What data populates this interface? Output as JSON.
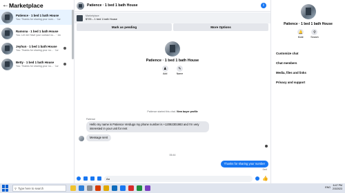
{
  "left": {
    "title": "Marketplace",
    "conversations": [
      {
        "name": "Patience · 1 bed 1 bath House",
        "snippet": "You: Thanks for sharing your num... · 1w"
      },
      {
        "name": "Ramona · 1 bed 1 bath House",
        "snippet": "You: Let me Have your contact nu... · 1w"
      },
      {
        "name": "Jeyhun · 1 bed 1 bath House",
        "snippet": "You: Thanks for sharing your nu... · 1w"
      },
      {
        "name": "Betty · 1 bed 1 bath House",
        "snippet": "You: Thanks for sharing your nu... · 1w"
      }
    ]
  },
  "middle": {
    "header_title": "Patience · 1 bed 1 bath House",
    "listing_label": "Marketplace",
    "listing_price": "$725 – 1 bed 1 bath House",
    "mark_pending": "Mark as pending",
    "more_options": "More Options",
    "profile_name": "Patience · 1 bed 1 bath House",
    "add_label": "Add",
    "name_label": "Name",
    "sys_msg_prefix": "Patience started this chat.",
    "sys_msg_link": "View buyer profile",
    "sender": "Patience",
    "msg1": "Hello my name is Patience Verdugo my phone number is +12092301983 and I'm very interested in your unit for rent",
    "msg2": "Message sent",
    "time": "06:44",
    "msg_out": "Thanks for sharing your number",
    "sent": "Sent",
    "composer_text": "Aa"
  },
  "right": {
    "name": "Patience · 1 bed 1 bath House",
    "mute": "Mute",
    "search": "Search",
    "menu": [
      "Customize chat",
      "Chat members",
      "Media, files and links",
      "Privacy and support"
    ]
  },
  "taskbar": {
    "search_placeholder": "Type here to search",
    "tray_lang": "ENG",
    "time": "6:47 PM",
    "date": "2/3/2023",
    "app_colors": [
      "#f0c330",
      "#2f7fd8",
      "#8a8f96",
      "#d83b01",
      "#e0a800",
      "#0f6cbd",
      "#1877f2",
      "#d62b2b",
      "#1e8e3e",
      "#7a3fc0"
    ]
  },
  "colors": {
    "accent": "#1877f2",
    "active_conv": "#e7f3ff",
    "taskbar": "#dfe4ee"
  }
}
